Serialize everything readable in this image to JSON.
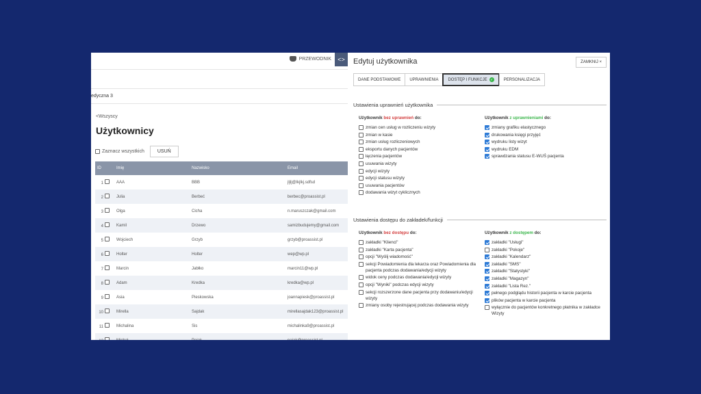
{
  "left": {
    "guide_label": "PRZEWODNIK",
    "toggle_icon": "code-toggle-icon",
    "breadcrumb_text": "edyczna 3",
    "back_link": "<Wszyscy",
    "title": "Użytkownicy",
    "select_all_label": "Zaznacz wszystkich",
    "delete_label": "USUŃ",
    "columns": [
      "ID",
      "Imię",
      "Nazwisko",
      "Email"
    ],
    "rows": [
      {
        "id": "1",
        "first": "AAA",
        "last": "BBB",
        "email": "jljlj@lkjlkj.sdfsd"
      },
      {
        "id": "2",
        "first": "Julia",
        "last": "Berbeć",
        "email": "berbec@proassist.pl"
      },
      {
        "id": "3",
        "first": "Olga",
        "last": "Cicha",
        "email": "n.maruszczak@gmail.com"
      },
      {
        "id": "4",
        "first": "Kamil",
        "last": "Drzewo",
        "email": "samizbudujemy@gmail.com"
      },
      {
        "id": "5",
        "first": "Wojciech",
        "last": "Grzyb",
        "email": "grzyb@proassist.pl"
      },
      {
        "id": "6",
        "first": "Holter",
        "last": "Holter",
        "email": "wep@wp.pl"
      },
      {
        "id": "7",
        "first": "Marcin",
        "last": "Jabłko",
        "email": "marcin11@wp.pl"
      },
      {
        "id": "8",
        "first": "Adam",
        "last": "Kredka",
        "email": "kredka@wp.pl"
      },
      {
        "id": "9",
        "first": "Asia",
        "last": "Pieskowska",
        "email": "joannapiesk@proassist.pl"
      },
      {
        "id": "10",
        "first": "Mirella",
        "last": "Sajdak",
        "email": "mirellasajdak123@proassist.pl"
      },
      {
        "id": "11",
        "first": "Michalina",
        "last": "Sis",
        "email": "michalinka9@proassist.pl"
      },
      {
        "id": "12",
        "first": "Michał",
        "last": "Pająk",
        "email": "pajak@proassist.pl"
      }
    ]
  },
  "right": {
    "title": "Edytuj użytkownika",
    "close_label": "ZAMKNIJ ×",
    "tabs": [
      {
        "label": "DANE PODSTAWOWE",
        "active": false
      },
      {
        "label": "UPRAWNIENIA",
        "active": false
      },
      {
        "label": "DOSTĘP I FUNKCJE",
        "active": true
      },
      {
        "label": "PERSONALIZACJA",
        "active": false
      }
    ],
    "tab_badge_icon": "check-badge-icon",
    "permissions": {
      "title": "Ustawienia uprawnień użytkownika",
      "without": {
        "prefix": "Użytkownik ",
        "highlight": "bez uprawnień",
        "suffix": " do:",
        "items": [
          "zmian cen usług w rozliczeniu wizyty",
          "zmian w kasie",
          "zmian usług rozliczeniowych",
          "eksportu danych pacjentów",
          "łączenia pacjentów",
          "usuwania wizyty",
          "edycji wizyty",
          "edycji statusu wizyty",
          "usuwania pacjentów",
          "dodawania wizyt cyklicznych"
        ]
      },
      "with": {
        "prefix": "Użytkownik ",
        "highlight": "z uprawnieniami",
        "suffix": " do:",
        "items": [
          "zmiany grafiku elastycznego",
          "drukowania księgi przyjęć",
          "wydruku listy wizyt",
          "wydruku EDM",
          "sprawdzania statusu E-WUŚ pacjenta"
        ]
      }
    },
    "access": {
      "title": "Ustawienia dostępu do zakładek/funkcji",
      "without": {
        "prefix": "Użytkownik ",
        "highlight": "bez dostępu",
        "suffix": " do:",
        "items": [
          "zakładki \"Klienci\"",
          "zakładki \"Karta pacjenta\"",
          "opcji \"Wyślij wiadomość\"",
          "sekcji Powiadomienia dla lekarza oraz Powiadomienia dla pacjenta podczas dodawania/edycji wizyty",
          "widok ceny podczas dodawania/edycji wizyty",
          "opcji \"Wyniki\" podczas edycji wizyty",
          "sekcji rozszerzone dane pacjenta przy dodawaniu/edycji wizyty",
          "zmiany osoby rejestrującej podczas dodawania wizyty"
        ]
      },
      "with": {
        "prefix": "Użytkownik ",
        "highlight": "z dostępem",
        "suffix": " do:",
        "items": [
          "zakładki \"Usługi\"",
          "zakładki \"Pokoje\"",
          "zakładki \"Kalendarz\"",
          "zakładki \"SMS\"",
          "zakładki \"Statystyki\"",
          "zakładki \"Magazyn\"",
          "zakładki \"Lista Rez.\"",
          "pełnego podglądu historii pacjenta w karcie pacjenta",
          "plików pacjenta w karcie pacjenta",
          "wyłącznie do pacjentów konkretnego płatnika w zakładce Wizyty"
        ],
        "checked": [
          true,
          false,
          true,
          true,
          true,
          true,
          true,
          true,
          true,
          false
        ]
      }
    }
  },
  "colors": {
    "background": "#14286e",
    "table_header": "#8a95a8",
    "checkbox_on": "#2e7bd6",
    "red": "#d23b3b",
    "green": "#39b54a"
  }
}
